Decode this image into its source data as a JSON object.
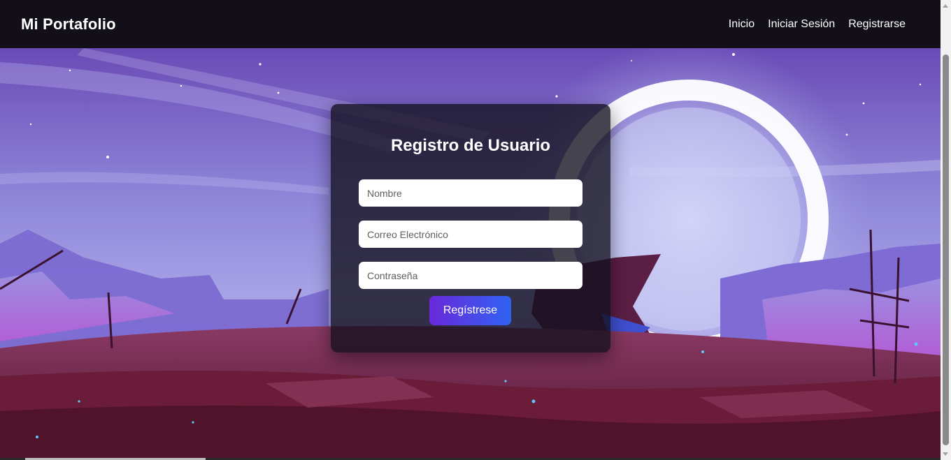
{
  "navbar": {
    "brand": "Mi Portafolio",
    "links": [
      {
        "label": "Inicio"
      },
      {
        "label": "Iniciar Sesión"
      },
      {
        "label": "Registrarse"
      }
    ]
  },
  "register_form": {
    "title": "Registro de Usuario",
    "name_placeholder": "Nombre",
    "email_placeholder": "Correo Electrónico",
    "password_placeholder": "Contraseña",
    "submit_label": "Regístrese"
  },
  "colors": {
    "navbar_bg": "#130f19",
    "button_gradient_start": "#6a28da",
    "button_gradient_end": "#2f63f2",
    "sky_top": "#6b4fb8",
    "ground": "#6e1f3c"
  }
}
